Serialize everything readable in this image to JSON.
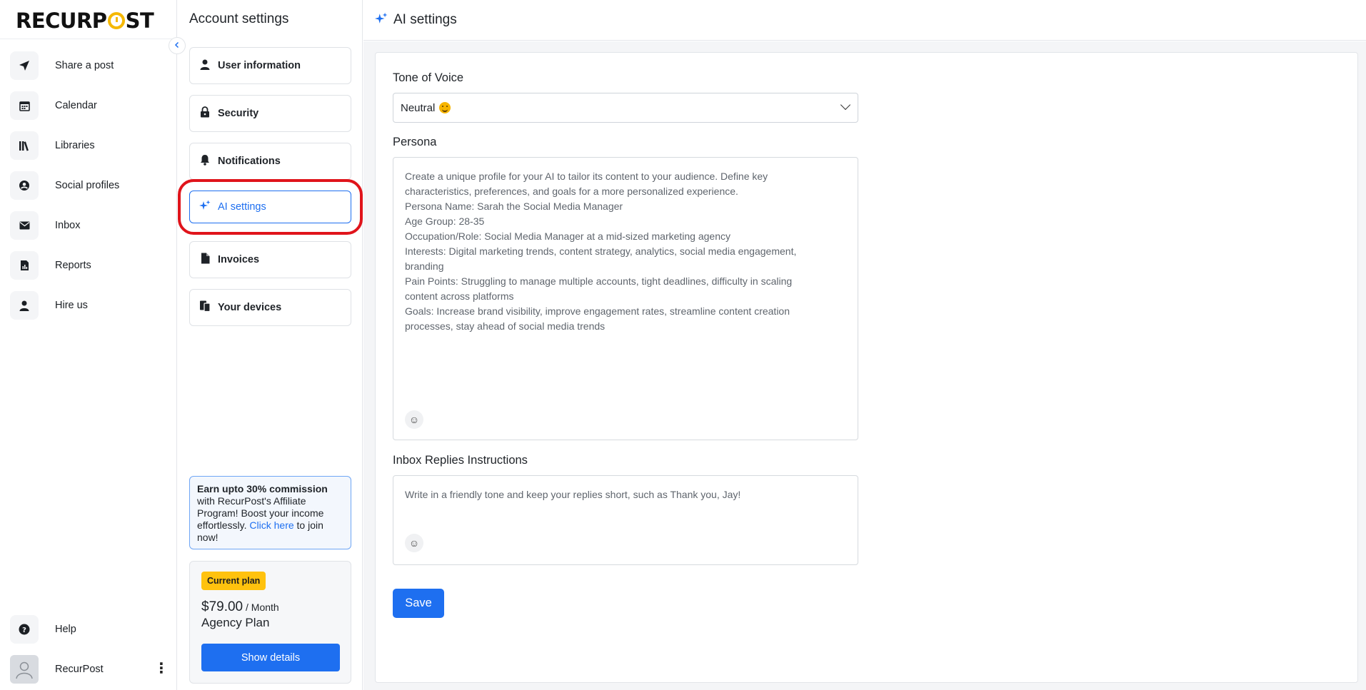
{
  "brand": {
    "logo_prefix": "RECURP",
    "logo_suffix": "ST",
    "accent": "#1e6ff0",
    "highlight": "#e0141b"
  },
  "nav": {
    "items": [
      {
        "label": "Share a post",
        "icon": "send-icon"
      },
      {
        "label": "Calendar",
        "icon": "calendar-icon"
      },
      {
        "label": "Libraries",
        "icon": "library-icon"
      },
      {
        "label": "Social profiles",
        "icon": "profile-icon"
      },
      {
        "label": "Inbox",
        "icon": "inbox-icon"
      },
      {
        "label": "Reports",
        "icon": "reports-icon"
      },
      {
        "label": "Hire us",
        "icon": "person-icon"
      }
    ],
    "help_label": "Help",
    "user_name": "RecurPost"
  },
  "account": {
    "title": "Account settings",
    "items": [
      {
        "label": "User information",
        "icon": "user-icon"
      },
      {
        "label": "Security",
        "icon": "lock-icon"
      },
      {
        "label": "Notifications",
        "icon": "bell-icon"
      },
      {
        "label": "AI settings",
        "icon": "sparkle-icon",
        "active": true
      },
      {
        "label": "Invoices",
        "icon": "document-icon"
      },
      {
        "label": "Your devices",
        "icon": "devices-icon"
      }
    ],
    "promo": {
      "bold": "Earn upto 30% commission",
      "text1": " with RecurPost's Affiliate Program! Boost your income effortlessly. ",
      "link": "Click here",
      "text2": " to join now!"
    },
    "plan": {
      "badge": "Current plan",
      "price": "$79.00",
      "period": " / Month",
      "name": "Agency Plan",
      "button": "Show details"
    }
  },
  "main": {
    "title": "AI settings",
    "tone": {
      "label": "Tone of Voice",
      "value": "Neutral"
    },
    "persona": {
      "label": "Persona",
      "lines": [
        "Create a unique profile for your AI to tailor its content to your audience. Define key",
        "characteristics, preferences, and goals for a more personalized experience.",
        "Persona Name: Sarah the Social Media Manager",
        "Age Group: 28-35",
        "Occupation/Role: Social Media Manager at a mid-sized marketing agency",
        "Interests: Digital marketing trends, content strategy, analytics, social media engagement,",
        "branding",
        "Pain Points: Struggling to manage multiple accounts, tight deadlines, difficulty in scaling",
        "content across platforms",
        "Goals: Increase brand visibility, improve engagement rates, streamline content creation",
        "processes, stay ahead of social media trends"
      ]
    },
    "inbox": {
      "label": "Inbox Replies Instructions",
      "text": "Write in a friendly tone and keep your replies short, such as Thank you, Jay!"
    },
    "save_label": "Save"
  }
}
